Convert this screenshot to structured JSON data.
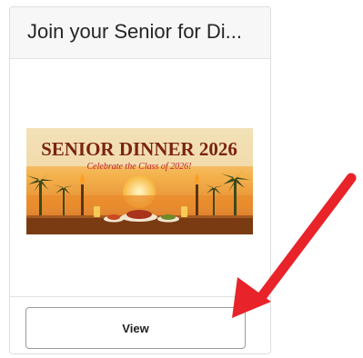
{
  "card": {
    "title": "Join your Senior for Di...",
    "image": {
      "headline": "SENIOR DINNER 2026",
      "tagline": "Celebrate the Class of 2026!"
    },
    "view_button_label": "View"
  },
  "colors": {
    "arrow": "#e8232a",
    "headline": "#7a2412",
    "tagline": "#c0202a"
  },
  "icons": {
    "annotation": "red-arrow-icon"
  }
}
